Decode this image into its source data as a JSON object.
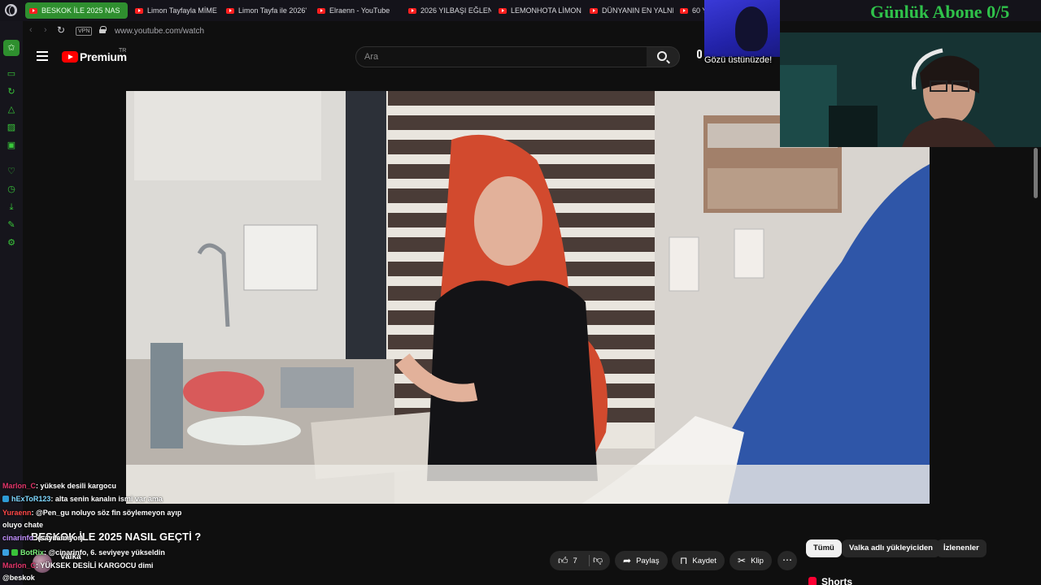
{
  "browser": {
    "tabs": [
      {
        "label": "BESKOK İLE 2025 NAS",
        "active": true
      },
      {
        "label": "Limon Tayfayla MİME",
        "active": false
      },
      {
        "label": "Limon Tayfa ile 2026'",
        "active": false
      },
      {
        "label": "Elraenn - YouTube",
        "active": false
      },
      {
        "label": "2026 YILBAŞI EĞLEN",
        "active": false
      },
      {
        "label": "LEMONHOTA LİMON",
        "active": false
      },
      {
        "label": "DÜNYANIN EN YALNI",
        "active": false
      },
      {
        "label": "60 Y",
        "active": false
      }
    ],
    "vpn_label": "VPN",
    "url": "www.youtube.com/watch",
    "accent": "#2f8f2f"
  },
  "youtube": {
    "brand": "Premium",
    "brand_region": "TR",
    "search_placeholder": "Ara",
    "video_title": "BESKOK İLE 2025 NASIL GEÇTİ ?",
    "channel_name": "Valka",
    "likes": "7",
    "actions": {
      "share": "Paylaş",
      "save": "Kaydet",
      "clip": "Klip"
    },
    "chips": [
      "Tümü",
      "Valka adlı yükleyiciden",
      "İzlenenler"
    ],
    "shorts_label": "Shorts"
  },
  "stream_overlay": {
    "daily_sub_goal": "Günlük Abone 0/5",
    "avatar_caption": "Gözü üstünüzde!"
  },
  "chat": [
    {
      "user": "Marlon_C",
      "message": ": yüksek desili kargocu"
    },
    {
      "user": "hExToR123",
      "message": ": alta senin kanalın ismi var ama"
    },
    {
      "user": "Yuraenn",
      "message": ": @Pen_gu noluyo söz fin söylemeyon ayıp"
    },
    {
      "user": "",
      "message": "oluyo chate"
    },
    {
      "user": "cinarinfo",
      "message": ": (sayılamıyor)"
    },
    {
      "user": "BotRix",
      "message": ": @cinarinfo, 6. seviyeye yükseldin"
    },
    {
      "user": "Marlon_C",
      "message": ": YÜKSEK DESİLİ KARGOCU dimi"
    },
    {
      "user": "",
      "message": "@beskok"
    }
  ]
}
